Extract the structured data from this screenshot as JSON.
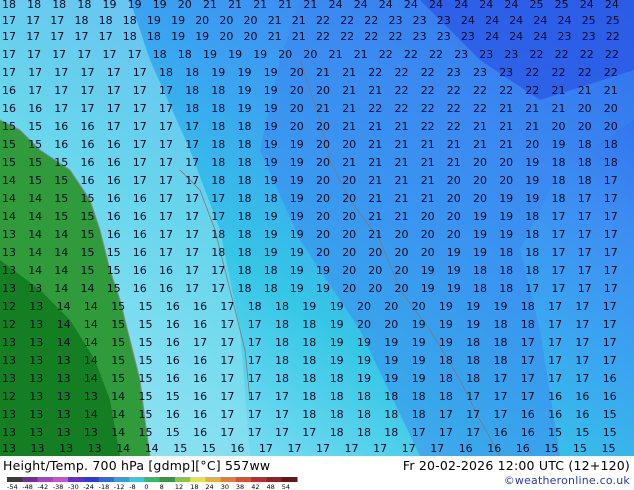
{
  "map": {
    "title": "Height/Temp. 700 hPa [gdmp][°C] 557ww",
    "valid_time": "Fr 20-02-2026 12:00 UTC (12+120)",
    "credit": "©weatheronline.co.uk",
    "colors": {
      "land": "#2f9b3a",
      "land_dark": "#0f7a1c",
      "sea_band_light": "#9fe6ee",
      "sea_band_mid": "#35c7e6",
      "sea_band_blue": "#3d8ef2",
      "sea_band_deep": "#2a58e6",
      "coast": "#8a8a8a",
      "contour_label": "#0a0a28"
    },
    "colorbar": {
      "ticks": [
        "-54",
        "-48",
        "-42",
        "-38",
        "-30",
        "-24",
        "-18",
        "-12",
        "-8",
        "0",
        "8",
        "12",
        "18",
        "24",
        "30",
        "38",
        "42",
        "48",
        "54"
      ],
      "colors": [
        "#3b3b3b",
        "#7a2a9a",
        "#b23cd0",
        "#d24cd8",
        "#6b2ad8",
        "#2a3ae6",
        "#2a6ae6",
        "#2aa0e6",
        "#2ad0e6",
        "#30c060",
        "#2f9b3a",
        "#88c83c",
        "#e6e636",
        "#e6b030",
        "#e67e2a",
        "#e64c2a",
        "#c8282a",
        "#9a1e1e",
        "#6a1414"
      ]
    },
    "contour_labels": [
      "24",
      "21",
      "19",
      "20",
      "25",
      "18",
      "17",
      "23",
      "22",
      "16",
      "15",
      "14",
      "13",
      "12"
    ]
  }
}
